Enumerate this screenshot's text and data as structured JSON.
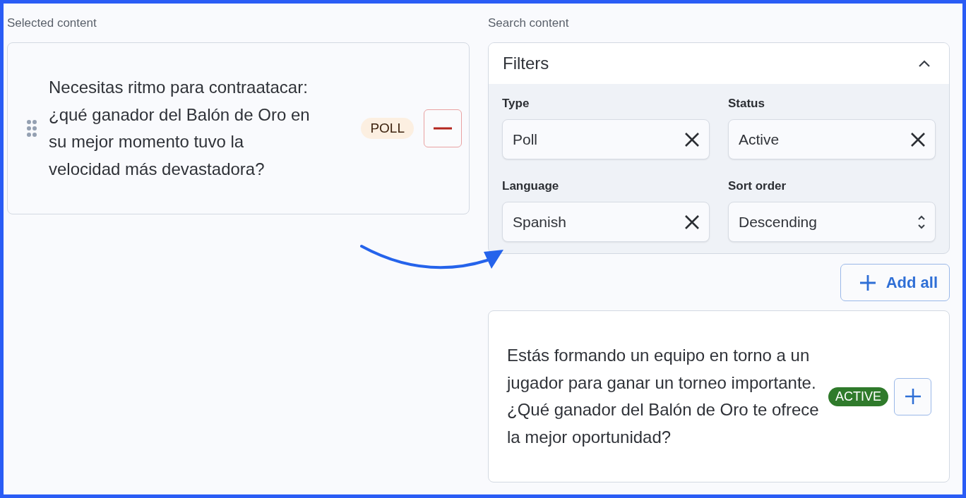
{
  "selected_content": {
    "label": "Selected content",
    "items": [
      {
        "text": "Necesitas ritmo para contraatacar: ¿qué ganador del Balón de Oro en su mejor momento tuvo la velocidad más devastadora?",
        "badge": {
          "text": "POLL",
          "kind": "type"
        }
      }
    ]
  },
  "search_content": {
    "label": "Search content",
    "filters": {
      "title": "Filters",
      "expanded": true,
      "fields": [
        {
          "label": "Type",
          "value": "Poll",
          "kind": "clearable"
        },
        {
          "label": "Status",
          "value": "Active",
          "kind": "clearable"
        },
        {
          "label": "Language",
          "value": "Spanish",
          "kind": "clearable"
        },
        {
          "label": "Sort order",
          "value": "Descending",
          "kind": "select"
        }
      ]
    },
    "add_all": "Add all",
    "results": [
      {
        "text": "Estás formando un equipo en torno a un jugador para ganar un torneo importante. ¿Qué ganador del Balón de Oro te ofrece la mejor oportunidad?",
        "badge": {
          "text": "ACTIVE",
          "kind": "status"
        }
      }
    ]
  }
}
